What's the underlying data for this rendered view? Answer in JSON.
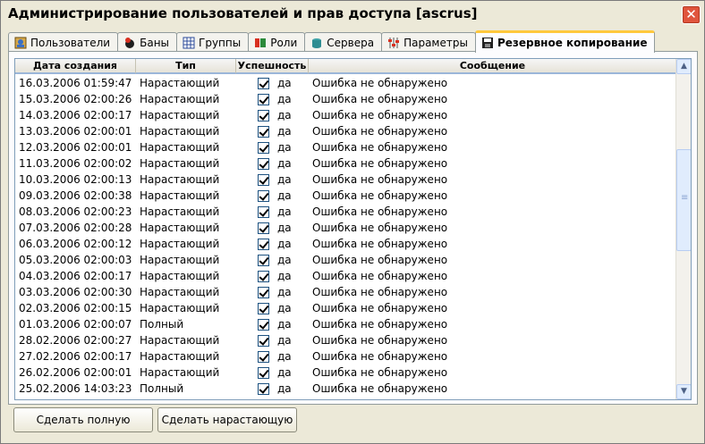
{
  "window": {
    "title": "Администрирование пользователей и прав доступа [ascrus]",
    "close_glyph": "✕"
  },
  "tabs": [
    {
      "label": "Пользователи",
      "icon": "users-icon"
    },
    {
      "label": "Баны",
      "icon": "ban-icon"
    },
    {
      "label": "Группы",
      "icon": "groups-icon"
    },
    {
      "label": "Роли",
      "icon": "roles-icon"
    },
    {
      "label": "Сервера",
      "icon": "servers-icon"
    },
    {
      "label": "Параметры",
      "icon": "params-icon"
    },
    {
      "label": "Резервное копирование",
      "icon": "backup-icon",
      "active": true
    }
  ],
  "table": {
    "columns": [
      "Дата создания",
      "Тип",
      "Успешность",
      "Сообщение"
    ],
    "rows": [
      {
        "date": "16.03.2006 01:59:47",
        "type": "Нарастающий",
        "ok": "да",
        "msg": "Ошибка не обнаружено"
      },
      {
        "date": "15.03.2006 02:00:26",
        "type": "Нарастающий",
        "ok": "да",
        "msg": "Ошибка не обнаружено"
      },
      {
        "date": "14.03.2006 02:00:17",
        "type": "Нарастающий",
        "ok": "да",
        "msg": "Ошибка не обнаружено"
      },
      {
        "date": "13.03.2006 02:00:01",
        "type": "Нарастающий",
        "ok": "да",
        "msg": "Ошибка не обнаружено"
      },
      {
        "date": "12.03.2006 02:00:01",
        "type": "Нарастающий",
        "ok": "да",
        "msg": "Ошибка не обнаружено"
      },
      {
        "date": "11.03.2006 02:00:02",
        "type": "Нарастающий",
        "ok": "да",
        "msg": "Ошибка не обнаружено"
      },
      {
        "date": "10.03.2006 02:00:13",
        "type": "Нарастающий",
        "ok": "да",
        "msg": "Ошибка не обнаружено"
      },
      {
        "date": "09.03.2006 02:00:38",
        "type": "Нарастающий",
        "ok": "да",
        "msg": "Ошибка не обнаружено"
      },
      {
        "date": "08.03.2006 02:00:23",
        "type": "Нарастающий",
        "ok": "да",
        "msg": "Ошибка не обнаружено"
      },
      {
        "date": "07.03.2006 02:00:28",
        "type": "Нарастающий",
        "ok": "да",
        "msg": "Ошибка не обнаружено"
      },
      {
        "date": "06.03.2006 02:00:12",
        "type": "Нарастающий",
        "ok": "да",
        "msg": "Ошибка не обнаружено"
      },
      {
        "date": "05.03.2006 02:00:03",
        "type": "Нарастающий",
        "ok": "да",
        "msg": "Ошибка не обнаружено"
      },
      {
        "date": "04.03.2006 02:00:17",
        "type": "Нарастающий",
        "ok": "да",
        "msg": "Ошибка не обнаружено"
      },
      {
        "date": "03.03.2006 02:00:30",
        "type": "Нарастающий",
        "ok": "да",
        "msg": "Ошибка не обнаружено"
      },
      {
        "date": "02.03.2006 02:00:15",
        "type": "Нарастающий",
        "ok": "да",
        "msg": "Ошибка не обнаружено"
      },
      {
        "date": "01.03.2006 02:00:07",
        "type": "Полный",
        "ok": "да",
        "msg": "Ошибка не обнаружено"
      },
      {
        "date": "28.02.2006 02:00:27",
        "type": "Нарастающий",
        "ok": "да",
        "msg": "Ошибка не обнаружено"
      },
      {
        "date": "27.02.2006 02:00:17",
        "type": "Нарастающий",
        "ok": "да",
        "msg": "Ошибка не обнаружено"
      },
      {
        "date": "26.02.2006 02:00:01",
        "type": "Нарастающий",
        "ok": "да",
        "msg": "Ошибка не обнаружено"
      },
      {
        "date": "25.02.2006 14:03:23",
        "type": "Полный",
        "ok": "да",
        "msg": "Ошибка не обнаружено"
      }
    ]
  },
  "scrollbar": {
    "up_glyph": "▲",
    "down_glyph": "▼"
  },
  "buttons": {
    "full": "Сделать полную",
    "incremental": "Сделать нарастающую"
  }
}
